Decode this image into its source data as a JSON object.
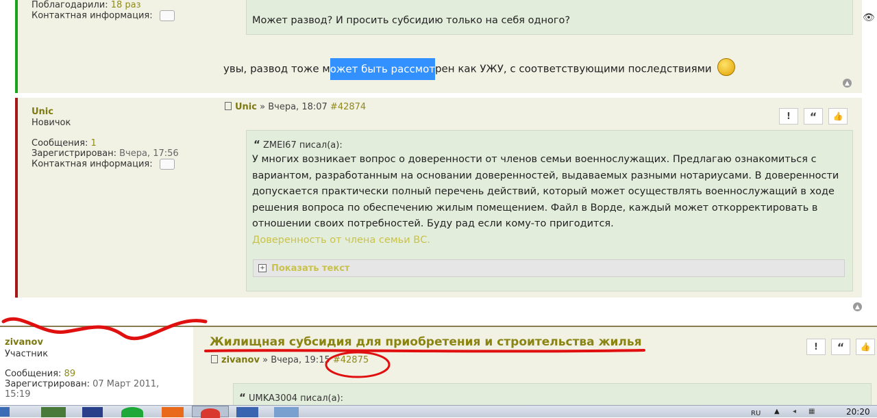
{
  "post1": {
    "thanks_label": "Поблагодарили:",
    "thanks_value": "18 раз",
    "contact_label": "Контактная информация:",
    "quote_text": "Может развод? И просить субсидию только на себя одного?",
    "reply_before": "увы, развод тоже м",
    "reply_selected": "ожет быть рассмот",
    "reply_after": "рен как УЖУ, с соответствующими последствиями"
  },
  "post2": {
    "author": "Unic",
    "rank": "Новичок",
    "messages_label": "Сообщения:",
    "messages_value": "1",
    "registered_label": "Зарегистрирован:",
    "registered_value": "Вчера, 17:56",
    "contact_label": "Контактная информация:",
    "header_author": "Unic",
    "header_sep": "»",
    "header_time": "Вчера, 18:07",
    "header_id": "#42874",
    "quote_author": "ZMEI67 писал(а):",
    "quote_lines": [
      "У многих возникает вопрос о доверенности от членов семьи военнослужащих. Предлагаю ознакомиться с",
      "вариантом, разработанным на основании доверенностей, выдаваемых разными нотариусами. В доверенности",
      "допускается практически полный перечень действий, который может осуществлять военнослужащий в ходе",
      "решения вопроса по обеспечению жилым помещением. Файл в Ворде, каждый может откорректировать в",
      "отношении своих потребностей. Буду рад если кому-то пригодится."
    ],
    "link": "Доверенность от члена семьи ВС.",
    "spoiler": "Показать текст"
  },
  "post3": {
    "author": "zivanov",
    "rank": "Участник",
    "messages_label": "Сообщения:",
    "messages_value": "89",
    "registered_label": "Зарегистрирован:",
    "registered_value_1": "07 Март 2011,",
    "registered_value_2": "15:19",
    "title": "Жилищная субсидия для приобретения и строительства жилья",
    "header_author": "zivanov",
    "header_sep": "»",
    "header_time": "Вчера, 19:15",
    "header_id": "#42875",
    "quote_author": "UMKA3004 писал(а):"
  },
  "buttons": {
    "report": "!",
    "quote": "“",
    "like": "👍"
  },
  "taskbar": {
    "lang": "RU",
    "clock": "20:20"
  },
  "colors": {
    "online": "#19a319",
    "offline": "#a31919",
    "accent": "#8f8a1b",
    "annotation": "#e01010"
  }
}
